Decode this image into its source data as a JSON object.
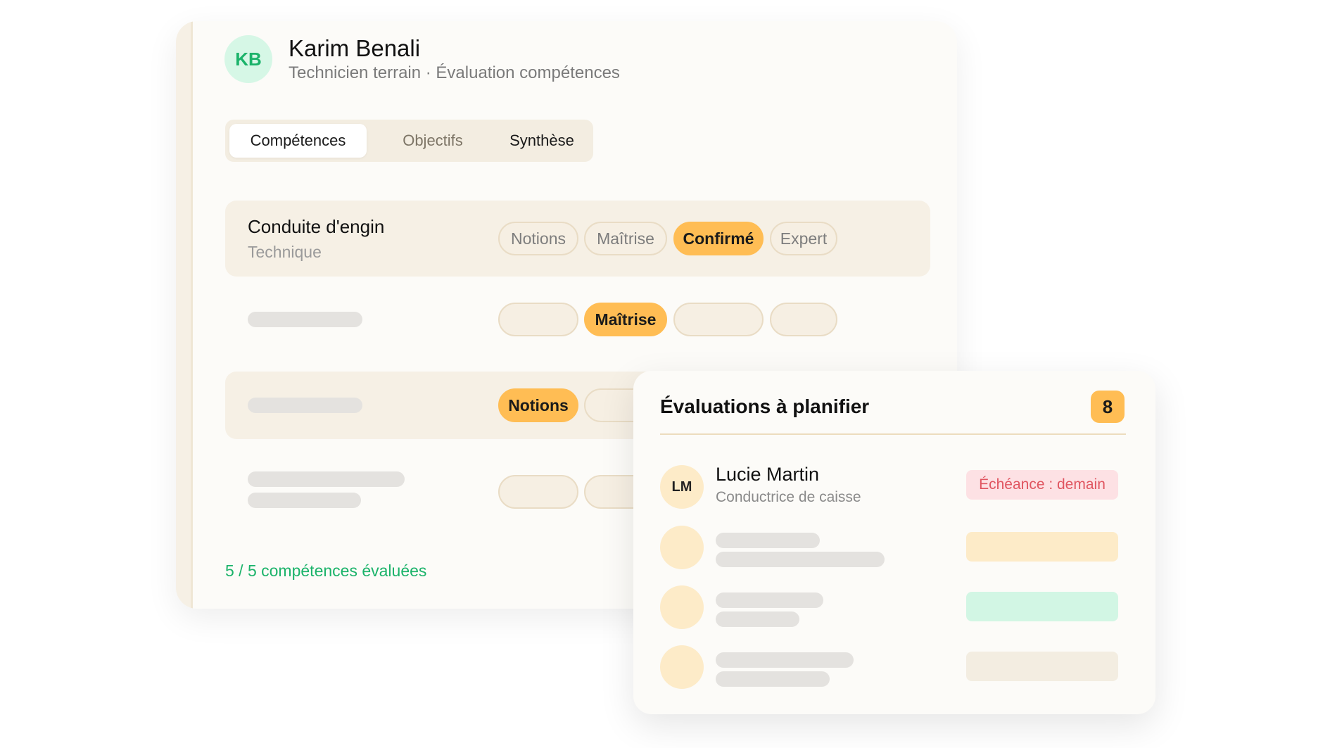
{
  "profile": {
    "initials": "KB",
    "name": "Karim Benali",
    "subtitle": "Technicien terrain · Évaluation compétences"
  },
  "tabs": [
    {
      "label": "Compétences",
      "active": true
    },
    {
      "label": "Objectifs",
      "active": false
    },
    {
      "label": "Synthèse",
      "active": false
    }
  ],
  "skills": [
    {
      "name": "Conduite d'engin",
      "category": "Technique",
      "levels": [
        "Notions",
        "Maîtrise",
        "Confirmé",
        "Expert"
      ],
      "selected": "Confirmé"
    },
    {
      "selected_label": "Maîtrise"
    },
    {
      "selected_label": "Notions"
    }
  ],
  "footer": {
    "count_text": "5 / 5 compétences évaluées"
  },
  "evaluations": {
    "title": "Évaluations à planifier",
    "count": "8",
    "entries": [
      {
        "initials": "LM",
        "name": "Lucie Martin",
        "role": "Conductrice de caisse",
        "due": "Échéance : demain"
      }
    ]
  },
  "colors": {
    "accent": "#ffbd54",
    "green": "#1bb36a",
    "danger": "#e05560",
    "panel": "#f6f0e5"
  }
}
